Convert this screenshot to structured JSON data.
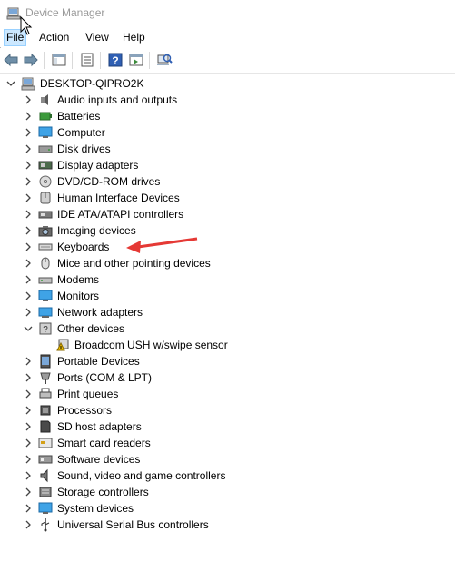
{
  "window": {
    "title": "Device Manager"
  },
  "menu": {
    "file": "File",
    "action": "Action",
    "view": "View",
    "help": "Help"
  },
  "tree": {
    "root": "DESKTOP-QIPRO2K",
    "categories": [
      {
        "label": "Audio inputs and outputs",
        "icon": "audio-icon"
      },
      {
        "label": "Batteries",
        "icon": "battery-icon"
      },
      {
        "label": "Computer",
        "icon": "computer-icon"
      },
      {
        "label": "Disk drives",
        "icon": "disk-drive-icon"
      },
      {
        "label": "Display adapters",
        "icon": "display-adapter-icon"
      },
      {
        "label": "DVD/CD-ROM drives",
        "icon": "dvd-drive-icon"
      },
      {
        "label": "Human Interface Devices",
        "icon": "hid-icon"
      },
      {
        "label": "IDE ATA/ATAPI controllers",
        "icon": "ide-controller-icon"
      },
      {
        "label": "Imaging devices",
        "icon": "camera-icon"
      },
      {
        "label": "Keyboards",
        "icon": "keyboard-icon"
      },
      {
        "label": "Mice and other pointing devices",
        "icon": "mouse-icon"
      },
      {
        "label": "Modems",
        "icon": "modem-icon"
      },
      {
        "label": "Monitors",
        "icon": "monitor-icon"
      },
      {
        "label": "Network adapters",
        "icon": "network-adapter-icon"
      },
      {
        "label": "Other devices",
        "icon": "other-devices-icon",
        "expanded": true,
        "children": [
          {
            "label": "Broadcom USH w/swipe sensor",
            "icon": "warning-device-icon"
          }
        ]
      },
      {
        "label": "Portable Devices",
        "icon": "portable-device-icon"
      },
      {
        "label": "Ports (COM & LPT)",
        "icon": "port-icon"
      },
      {
        "label": "Print queues",
        "icon": "printer-icon"
      },
      {
        "label": "Processors",
        "icon": "processor-icon"
      },
      {
        "label": "SD host adapters",
        "icon": "sd-adapter-icon"
      },
      {
        "label": "Smart card readers",
        "icon": "smart-card-icon"
      },
      {
        "label": "Software devices",
        "icon": "software-device-icon"
      },
      {
        "label": "Sound, video and game controllers",
        "icon": "sound-controller-icon"
      },
      {
        "label": "Storage controllers",
        "icon": "storage-controller-icon"
      },
      {
        "label": "System devices",
        "icon": "system-device-icon"
      },
      {
        "label": "Universal Serial Bus controllers",
        "icon": "usb-icon"
      }
    ]
  },
  "colors": {
    "accent": "#0078d7",
    "annotation_arrow": "#e53935",
    "menu_highlight": "#cce8ff"
  }
}
